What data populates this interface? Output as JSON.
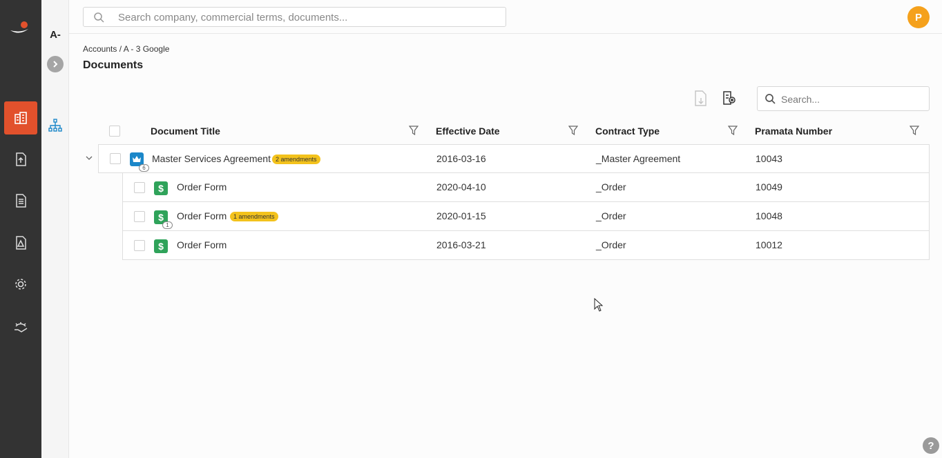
{
  "sub_nav": {
    "account_short": "A-"
  },
  "top_search": {
    "placeholder": "Search company, commercial terms, documents..."
  },
  "user": {
    "avatar_initial": "P"
  },
  "breadcrumb": "Accounts / A - 3 Google",
  "page_title": "Documents",
  "doc_search": {
    "placeholder": "Search..."
  },
  "table": {
    "columns": [
      "Document Title",
      "Effective Date",
      "Contract Type",
      "Pramata Number"
    ],
    "rows": [
      {
        "title": "Master Services Agreement",
        "amendments": "2 amendments",
        "child_count": "6",
        "date": "2016-03-16",
        "type": "_Master Agreement",
        "number": "10043"
      },
      {
        "title": "Order Form",
        "amendments": "",
        "child_count": "",
        "date": "2020-04-10",
        "type": "_Order",
        "number": "10049"
      },
      {
        "title": "Order Form",
        "amendments": "1 amendments",
        "child_count": "1",
        "date": "2020-01-15",
        "type": "_Order",
        "number": "10048"
      },
      {
        "title": "Order Form",
        "amendments": "",
        "child_count": "",
        "date": "2016-03-21",
        "type": "_Order",
        "number": "10012"
      }
    ]
  },
  "help_label": "?",
  "colors": {
    "rail": "#333333",
    "accent": "#e2512c",
    "avatar": "#f5a11c",
    "amend_badge": "#f3c21c",
    "msa_icon": "#1b87c9",
    "order_icon": "#2fa35a"
  },
  "icons": [
    "logo",
    "accounts-icon",
    "upload-document-icon",
    "reports-icon",
    "alerts-icon",
    "settings-icon",
    "handshake-icon",
    "hierarchy-icon",
    "search-icon",
    "export-pdf-icon",
    "document-settings-icon",
    "filter-icon",
    "crown-icon",
    "dollar-icon",
    "chevron-down-icon",
    "help-icon"
  ]
}
